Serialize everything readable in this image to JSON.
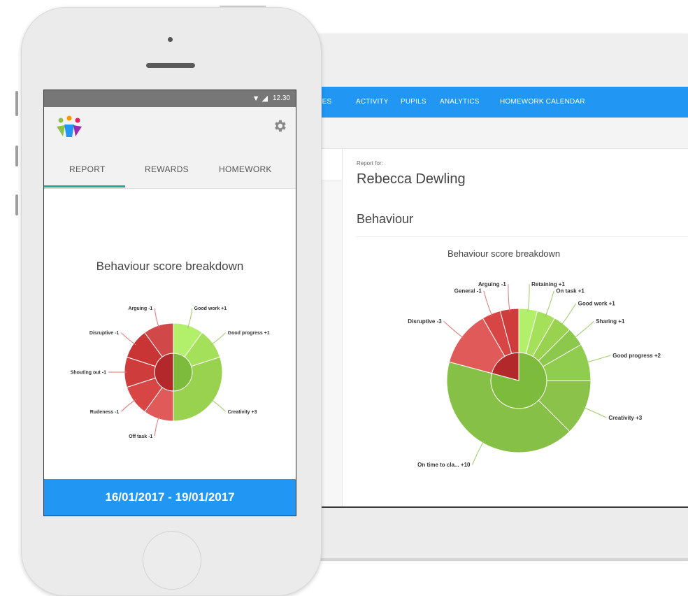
{
  "laptop": {
    "nav": [
      "ASSES",
      "ACTIVITY",
      "PUPILS",
      "ANALYTICS",
      "HOMEWORK CALENDAR"
    ],
    "report_for_label": "Report for:",
    "pupil_name": "Rebecca Dewling",
    "section_title": "Behaviour"
  },
  "phone": {
    "status_time": "12.30",
    "tabs": [
      "REPORT",
      "REWARDS",
      "HOMEWORK"
    ],
    "active_tab": "REPORT",
    "date_range": "16/01/2017 - 19/01/2017",
    "icons": {
      "logo": "people-logo-icon",
      "settings": "gear-icon",
      "status": "wifi-signal-icon"
    }
  },
  "colors": {
    "accent": "#2196f3",
    "tab_underline": "#26a69a",
    "positive": "#8bc34a",
    "negative": "#e53935"
  },
  "chart_data": [
    {
      "type": "pie",
      "title": "Behaviour score breakdown",
      "slices": [
        {
          "label": "Good work +1",
          "value": 1,
          "sign": "positive"
        },
        {
          "label": "Good progress +1",
          "value": 1,
          "sign": "positive"
        },
        {
          "label": "Creativity +3",
          "value": 3,
          "sign": "positive"
        },
        {
          "label": "Off task -1",
          "value": 1,
          "sign": "negative"
        },
        {
          "label": "Rudeness -1",
          "value": 1,
          "sign": "negative"
        },
        {
          "label": "Shouting out -1",
          "value": 1,
          "sign": "negative"
        },
        {
          "label": "Disruptive -1",
          "value": 1,
          "sign": "negative"
        },
        {
          "label": "Arguing -1",
          "value": 1,
          "sign": "negative"
        }
      ]
    },
    {
      "type": "pie",
      "title": "Behaviour score breakdown",
      "slices": [
        {
          "label": "Retaining +1",
          "value": 1,
          "sign": "positive"
        },
        {
          "label": "On task +1",
          "value": 1,
          "sign": "positive"
        },
        {
          "label": "Good work +1",
          "value": 1,
          "sign": "positive"
        },
        {
          "label": "Sharing +1",
          "value": 1,
          "sign": "positive"
        },
        {
          "label": "Good progress +2",
          "value": 2,
          "sign": "positive"
        },
        {
          "label": "Creativity +3",
          "value": 3,
          "sign": "positive"
        },
        {
          "label": "On time to cla... +10",
          "value": 10,
          "sign": "positive"
        },
        {
          "label": "Disruptive -3",
          "value": 3,
          "sign": "negative"
        },
        {
          "label": "General -1",
          "value": 1,
          "sign": "negative"
        },
        {
          "label": "Arguing -1",
          "value": 1,
          "sign": "negative"
        }
      ]
    }
  ]
}
